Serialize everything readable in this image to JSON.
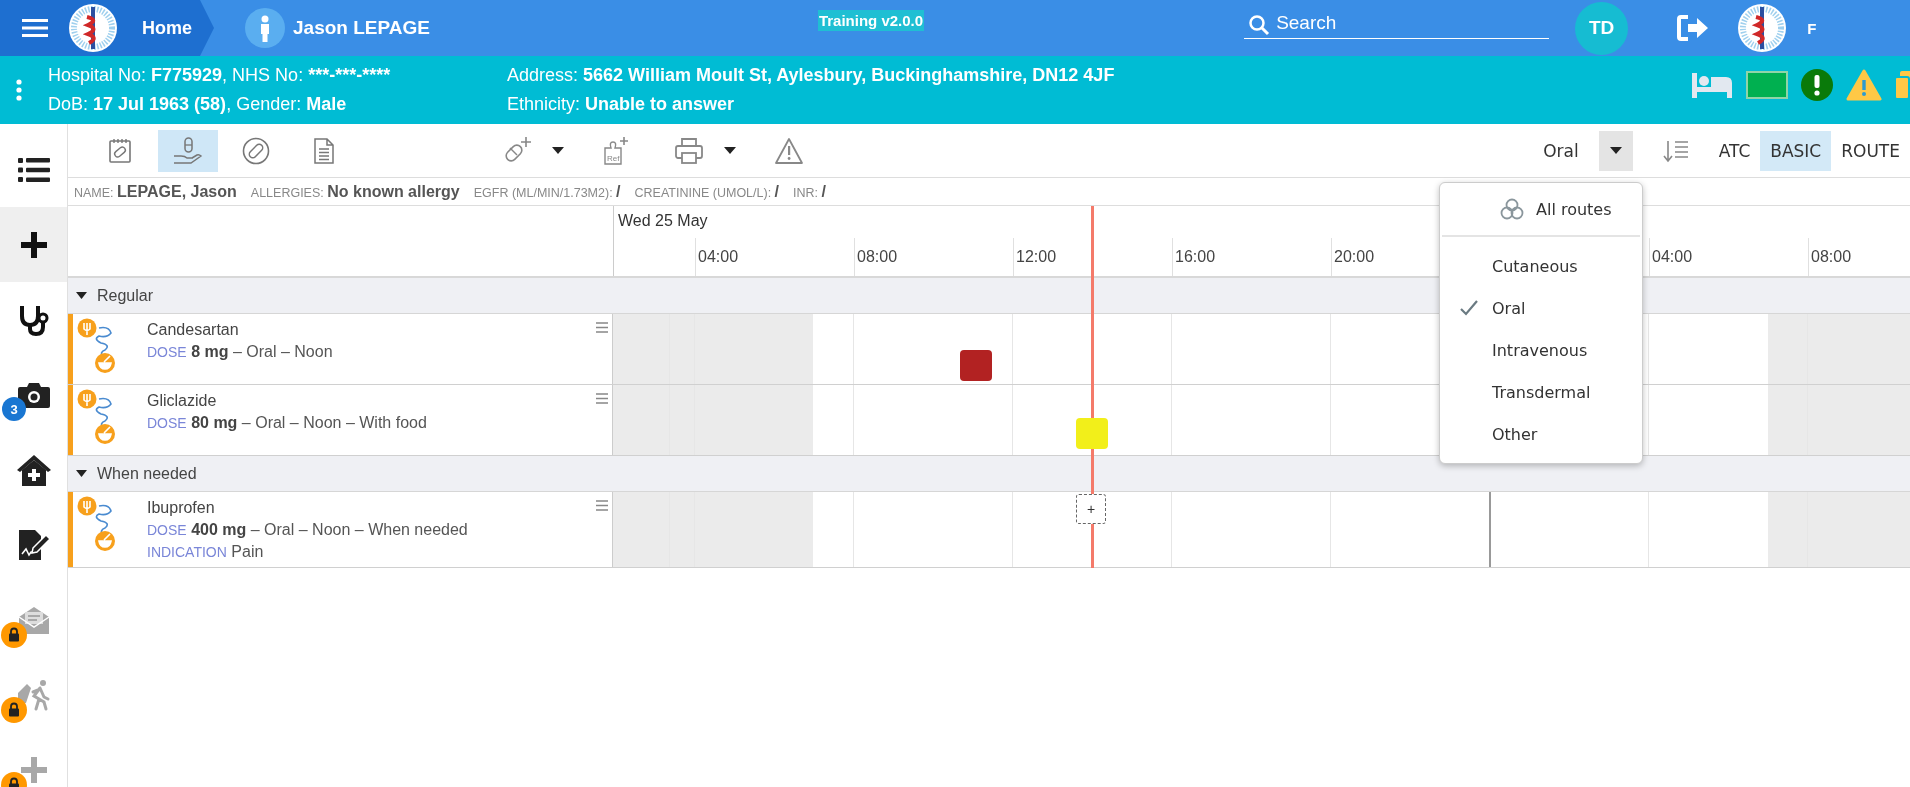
{
  "topbar": {
    "home": "Home",
    "patient": "Jason LEPAGE",
    "badge": "Training v2.0.0",
    "search_placeholder": "Search",
    "avatar": "TD",
    "user_cut": "F"
  },
  "banner": {
    "left": [
      [
        {
          "kind": "label",
          "t": "Hospital No: "
        },
        {
          "kind": "value",
          "t": "F775929"
        },
        {
          "kind": "label",
          "t": ", NHS No: "
        },
        {
          "kind": "value",
          "t": "***-***-****"
        }
      ],
      [
        {
          "kind": "label",
          "t": "DoB: "
        },
        {
          "kind": "value",
          "t": "17 Jul 1963 (58)"
        },
        {
          "kind": "label",
          "t": ", Gender: "
        },
        {
          "kind": "value",
          "t": "Male"
        }
      ]
    ],
    "right": [
      [
        {
          "kind": "label",
          "t": "Address: "
        },
        {
          "kind": "value",
          "t": "5662 William Moult St, Aylesbury, Buckinghamshire, DN12 4JF"
        }
      ],
      [
        {
          "kind": "label",
          "t": "Ethnicity: "
        },
        {
          "kind": "value",
          "t": "Unable to answer"
        }
      ]
    ]
  },
  "sidebar": [
    {
      "kind": "list",
      "selected": false,
      "locked": false
    },
    {
      "kind": "add",
      "selected": true,
      "locked": false
    },
    {
      "kind": "stethoscope",
      "selected": false,
      "locked": false
    },
    {
      "kind": "camera",
      "selected": false,
      "locked": false,
      "badge": "3"
    },
    {
      "kind": "home",
      "selected": false,
      "locked": false
    },
    {
      "kind": "sign",
      "selected": false,
      "locked": false
    },
    {
      "kind": "mail",
      "selected": false,
      "locked": true
    },
    {
      "kind": "walk",
      "selected": false,
      "locked": true
    },
    {
      "kind": "cross",
      "selected": false,
      "locked": true
    }
  ],
  "toolbar": {
    "tools": [
      {
        "kind": "chart",
        "selected": false
      },
      {
        "kind": "administer",
        "selected": true
      },
      {
        "kind": "pill",
        "selected": false
      },
      {
        "kind": "document",
        "selected": false
      }
    ],
    "actions": [
      {
        "kind": "add-pill",
        "menu": true
      },
      {
        "kind": "reference",
        "menu": false,
        "label": "Ref"
      },
      {
        "kind": "print",
        "menu": true
      },
      {
        "kind": "warning",
        "menu": false
      }
    ],
    "route_filter": "Oral",
    "views": [
      {
        "label": "ATC",
        "selected": false
      },
      {
        "label": "BASIC",
        "selected": true
      },
      {
        "label": "ROUTE",
        "selected": false
      }
    ]
  },
  "patient_info": [
    {
      "label": "NAME:",
      "value": "LEPAGE, Jason"
    },
    {
      "label": "ALLERGIES:",
      "value": "No known allergy"
    },
    {
      "label": "EGFR (ML/MIN/1.73M2):",
      "value": "/"
    },
    {
      "label": "CREATININE (UMOL/L):",
      "value": "/"
    },
    {
      "label": "INR:",
      "value": "/"
    }
  ],
  "timeline": {
    "date": "Wed 25 May",
    "ticks": [
      "04:00",
      "08:00",
      "12:00",
      "16:00",
      "20:00"
    ],
    "next_day_ticks": [
      "04:00",
      "08:00"
    ]
  },
  "groups": [
    {
      "name": "Regular",
      "expanded": true,
      "medications": [
        {
          "name": "Candesartan",
          "dose_label": "DOSE",
          "dose": "8 mg",
          "details": " – Oral – Noon",
          "markers": [
            {
              "kind": "missed",
              "color": "#b22222"
            }
          ]
        },
        {
          "name": "Gliclazide",
          "dose_label": "DOSE",
          "dose": "80 mg",
          "details": " – Oral – Noon – With food",
          "markers": [
            {
              "kind": "due",
              "color": "#f2ef1a"
            }
          ]
        }
      ]
    },
    {
      "name": "When needed",
      "expanded": true,
      "medications": [
        {
          "name": "Ibuprofen",
          "dose_label": "DOSE",
          "dose": "400 mg",
          "details": " – Oral – Noon – When needed",
          "indication_label": "INDICATION",
          "indication": "Pain",
          "markers": [
            {
              "kind": "add",
              "label": "+"
            }
          ]
        }
      ]
    }
  ],
  "route_menu": {
    "all": "All routes",
    "options": [
      {
        "label": "Cutaneous",
        "selected": false
      },
      {
        "label": "Oral",
        "selected": true
      },
      {
        "label": "Intravenous",
        "selected": false
      },
      {
        "label": "Transdermal",
        "selected": false
      },
      {
        "label": "Other",
        "selected": false
      }
    ]
  }
}
